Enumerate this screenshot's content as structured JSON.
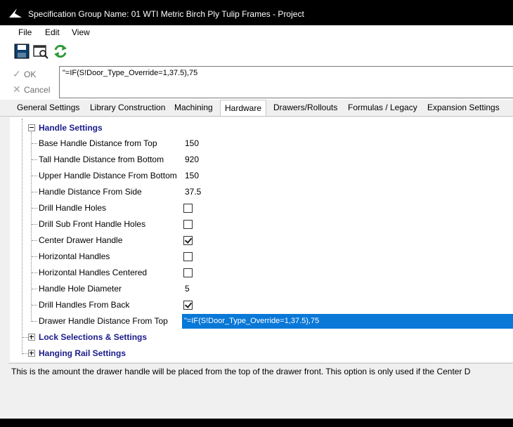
{
  "window": {
    "title": "Specification Group Name: 01 WTI Metric Birch Ply  Tulip Frames - Project"
  },
  "menu": {
    "items": [
      "File",
      "Edit",
      "View"
    ]
  },
  "toolbar": {
    "icons": [
      "save-icon",
      "preview-icon",
      "refresh-icon"
    ]
  },
  "commands": {
    "ok_label": "OK",
    "cancel_label": "Cancel"
  },
  "formula": {
    "value": "\"=IF(S!Door_Type_Override=1,37.5),75"
  },
  "tabs": {
    "items": [
      "General Settings",
      "Library Construction",
      "Machining",
      "Hardware",
      "Drawers/Rollouts",
      "Formulas / Legacy",
      "Expansion Settings"
    ],
    "active": "Hardware"
  },
  "grid": {
    "category_handle": "Handle Settings",
    "category_lock": "Lock Selections & Settings",
    "category_rail": "Hanging Rail Settings",
    "rows": [
      {
        "label": "Base Handle Distance from Top",
        "value": "150"
      },
      {
        "label": "Tall Handle Distance from Bottom",
        "value": "920"
      },
      {
        "label": "Upper Handle Distance From Bottom",
        "value": "150"
      },
      {
        "label": "Handle Distance From Side",
        "value": "37.5"
      },
      {
        "label": "Drill Handle Holes",
        "checked": false
      },
      {
        "label": "Drill Sub Front Handle Holes",
        "checked": false
      },
      {
        "label": "Center Drawer Handle",
        "checked": true
      },
      {
        "label": "Horizontal Handles",
        "checked": false
      },
      {
        "label": "Horizontal Handles Centered",
        "checked": false
      },
      {
        "label": "Handle Hole Diameter",
        "value": "5"
      },
      {
        "label": "Drill Handles From Back",
        "checked": true
      },
      {
        "label": "Drawer Handle Distance From Top",
        "value": "\"=IF(S!Door_Type_Override=1,37.5),75"
      }
    ]
  },
  "description": {
    "text": "This is the amount the drawer handle will be placed from the top of the drawer front. This option is only used if the Center D"
  },
  "colors": {
    "selection": "#0a78d7",
    "category_text": "#1b1b8c",
    "refresh_green": "#2e9a3a"
  }
}
